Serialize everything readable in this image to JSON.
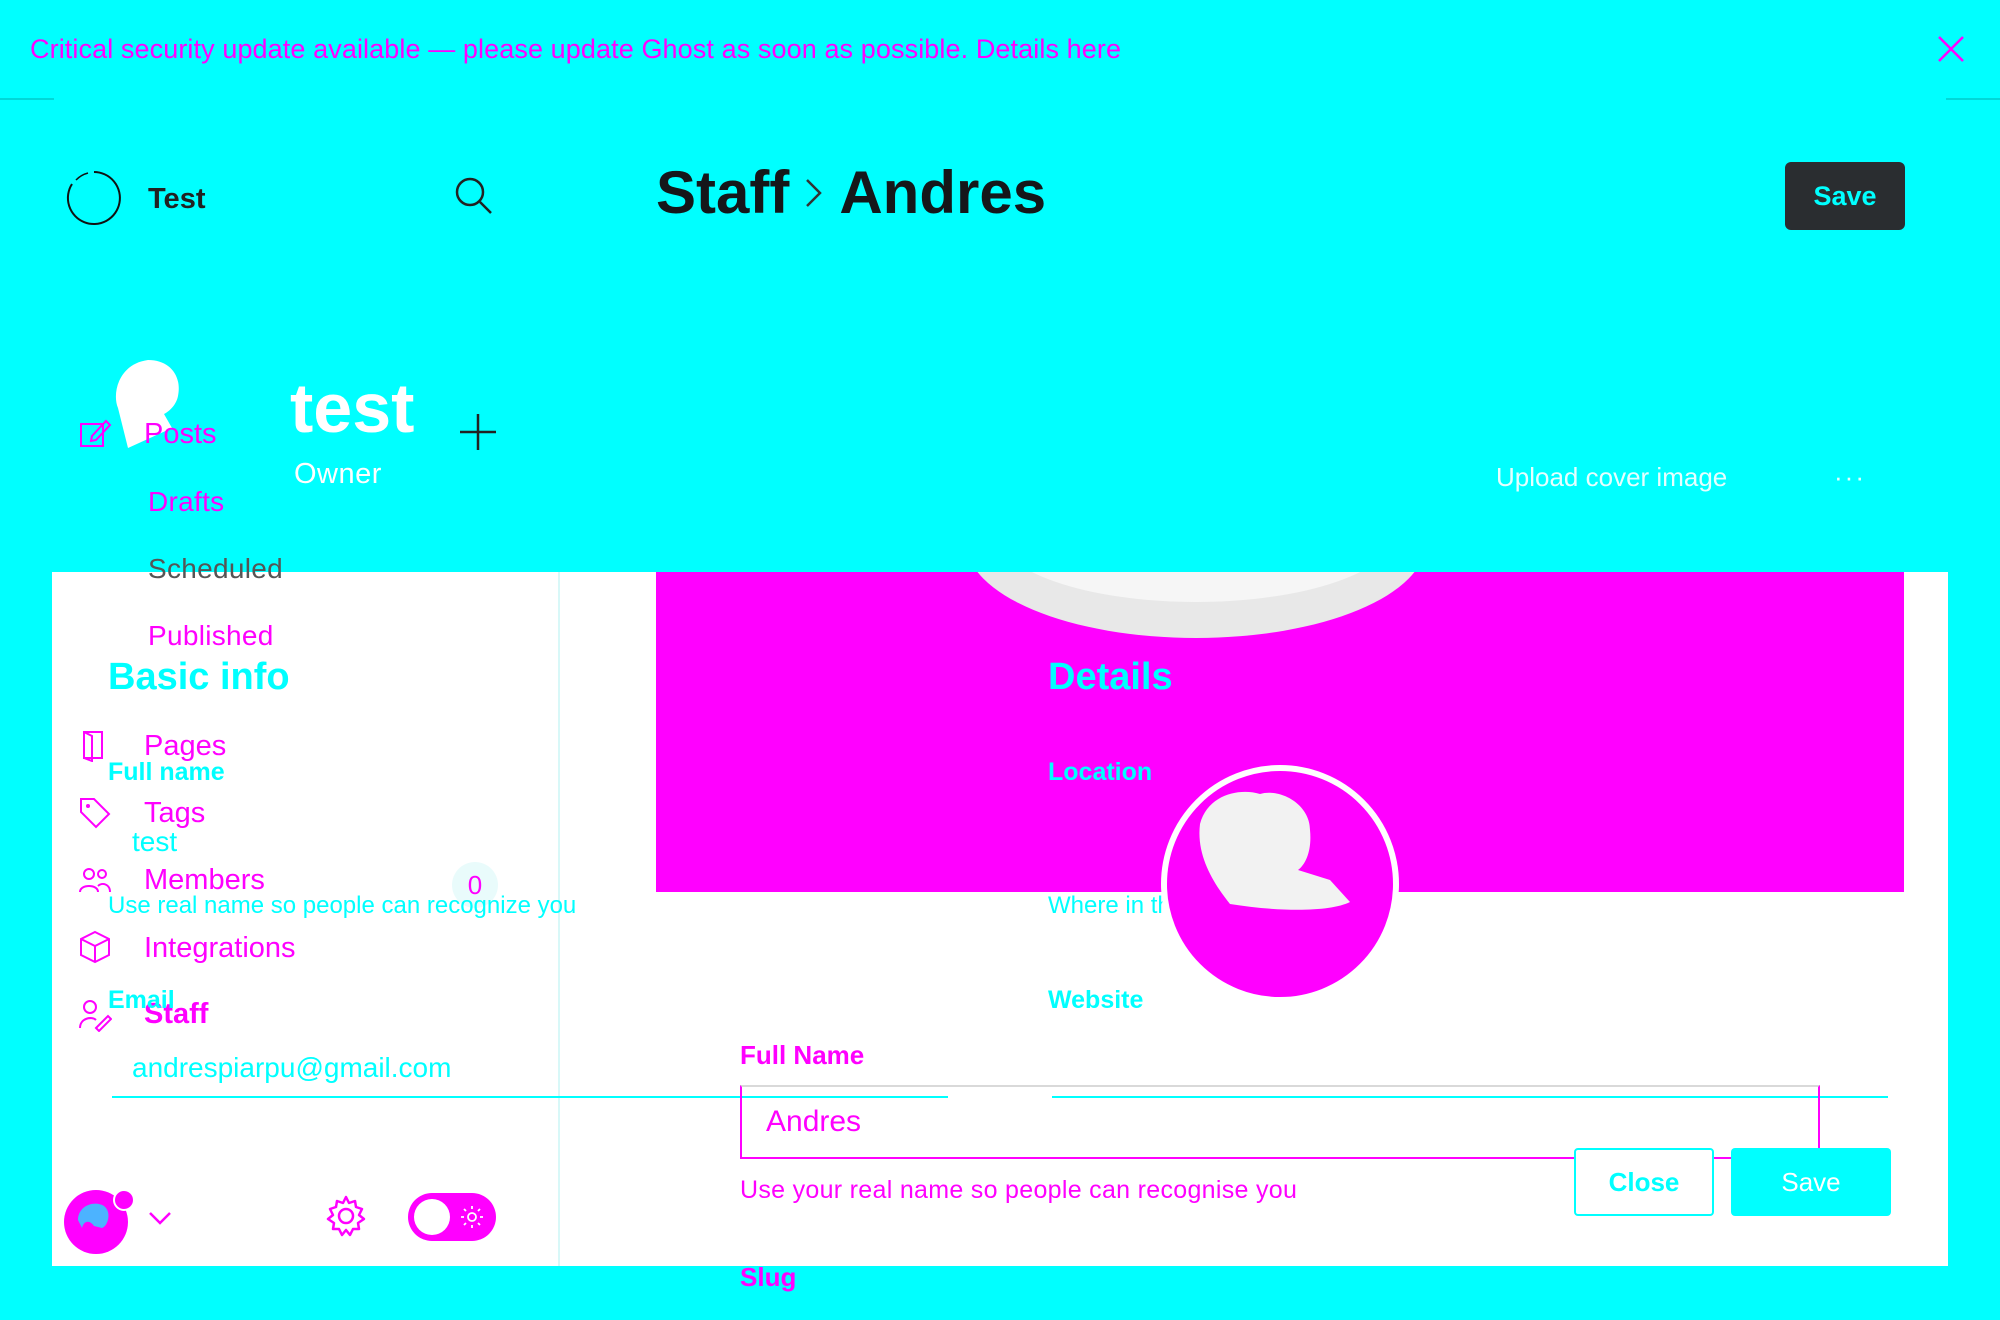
{
  "banner": {
    "message": "Critical security update available — please update Ghost as soon as possible. Details here",
    "close_icon": "close-icon"
  },
  "header": {
    "site_name": "Test",
    "breadcrumb": [
      "Staff",
      "Andres"
    ],
    "save_label": "Save"
  },
  "profile": {
    "name": "test",
    "role": "Owner",
    "upload_cover_label": "Upload cover image",
    "more_label": "···"
  },
  "nav": {
    "posts": "Posts",
    "drafts": "Drafts",
    "scheduled": "Scheduled",
    "published": "Published",
    "pages": "Pages",
    "tags": "Tags",
    "members": "Members",
    "members_count": "0",
    "integrations": "Integrations",
    "staff": "Staff"
  },
  "basic_info": {
    "title": "Basic info",
    "full_name_label": "Full name",
    "full_name_value": "test",
    "full_name_hint": "Use real name so people can recognize you",
    "email_label": "Email",
    "email_value": "andrespiarpu@gmail.com"
  },
  "details": {
    "title": "Details",
    "location_label": "Location",
    "location_hint": "Where in the world do you live?",
    "website_label": "Website"
  },
  "form": {
    "full_name_label": "Full Name",
    "full_name_value": "Andres",
    "full_name_hint": "Use your real name so people can recognise you",
    "slug_label": "Slug",
    "close_label": "Close",
    "save_label": "Save"
  },
  "colors": {
    "background": "#00ffff",
    "accent": "#ff00ff",
    "dark_button": "#2a2d30"
  }
}
